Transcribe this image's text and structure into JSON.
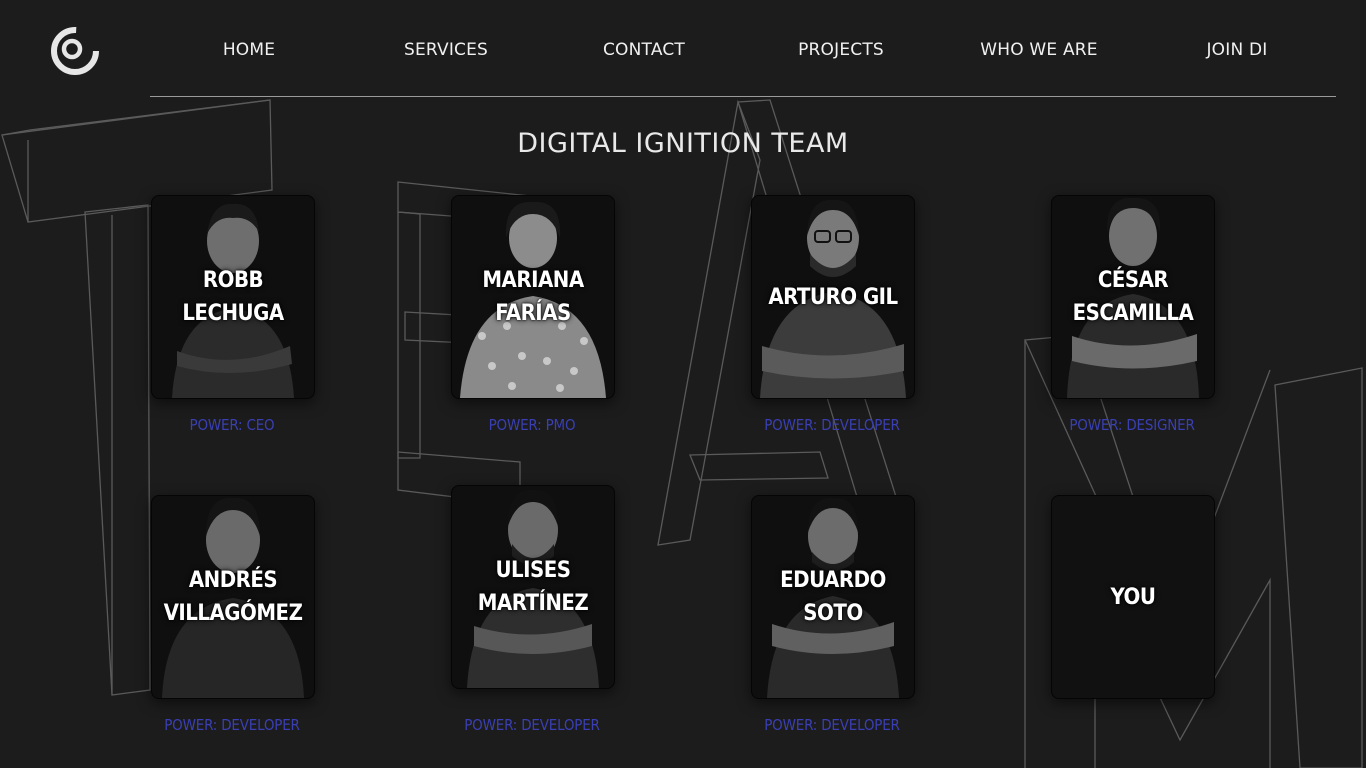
{
  "nav": {
    "items": [
      {
        "label": "HOME"
      },
      {
        "label": "SERVICES"
      },
      {
        "label": "CONTACT"
      },
      {
        "label": "PROJECTS"
      },
      {
        "label": "WHO WE ARE"
      },
      {
        "label": "JOIN DI"
      }
    ]
  },
  "page": {
    "title": "DIGITAL IGNITION TEAM"
  },
  "team": [
    {
      "name": "ROBB LECHUGA",
      "role": "POWER: CEO"
    },
    {
      "name": "MARIANA FARÍAS",
      "role": "POWER: PMO"
    },
    {
      "name": "ARTURO GIL",
      "role": "POWER: DEVELOPER"
    },
    {
      "name": "CÉSAR ESCAMILLA",
      "role": "POWER: DESIGNER"
    },
    {
      "name": "ANDRÉS VILLAGÓMEZ",
      "role": "POWER: DEVELOPER"
    },
    {
      "name": "ULISES MARTÍNEZ",
      "role": "POWER: DEVELOPER"
    },
    {
      "name": "EDUARDO SOTO",
      "role": "POWER: DEVELOPER"
    },
    {
      "name": "YOU",
      "role": ""
    }
  ],
  "colors": {
    "background": "#1c1c1c",
    "role_text": "#3a3fb3",
    "nav_text": "#f0f0f0"
  },
  "icons": {
    "logo": "digital-ignition-logo-icon"
  }
}
